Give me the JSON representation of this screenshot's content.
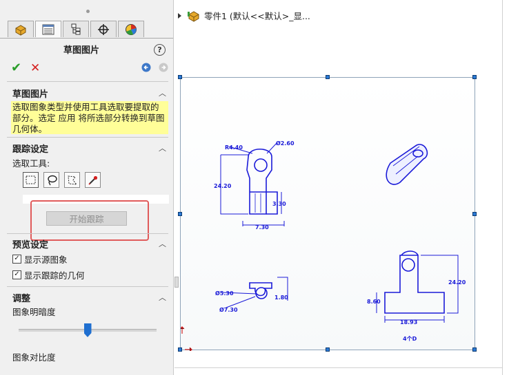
{
  "property_manager": {
    "title": "草图图片",
    "help_label": "?",
    "tabs": [
      "feature-manager-icon",
      "property-manager-icon",
      "configuration-manager-icon",
      "dimxpert-icon",
      "display-manager-icon"
    ]
  },
  "sections": {
    "sketch_picture": {
      "title": "草图图片",
      "hint": "选取图象类型并使用工具选取要提取的部分。选定 应用 将所选部分转换到草图几何体。"
    },
    "trace_settings": {
      "title": "跟踪设定",
      "select_tool_label": "选取工具:",
      "start_button": "开始跟踪"
    },
    "preview_settings": {
      "title": "预览设定",
      "show_source": "显示源图象",
      "show_traced": "显示跟踪的几何"
    },
    "adjust": {
      "title": "调整",
      "brightness_label": "图象明暗度",
      "brightness_value": 0.5,
      "contrast_label": "图象对比度"
    }
  },
  "tree": {
    "item": "零件1  (默认<<默认>_显..."
  },
  "drawing": {
    "dims": {
      "r440": "R4.40",
      "d260": "Ø2.60",
      "h2420_left": "24.20",
      "w730": "7.30",
      "v330": "3.30",
      "d530": "Ø5.30",
      "d730": "Ø7.30",
      "v180": "1.80",
      "h2420_right": "24.20",
      "v860": "8.60",
      "w1893": "18.93",
      "qty": "4个D"
    }
  },
  "colors": {
    "sketch_blue": "#1a1ad8",
    "accent_blue": "#1f6fd0",
    "hint_yellow": "#fffe98",
    "highlight_red": "#e05a5a"
  }
}
